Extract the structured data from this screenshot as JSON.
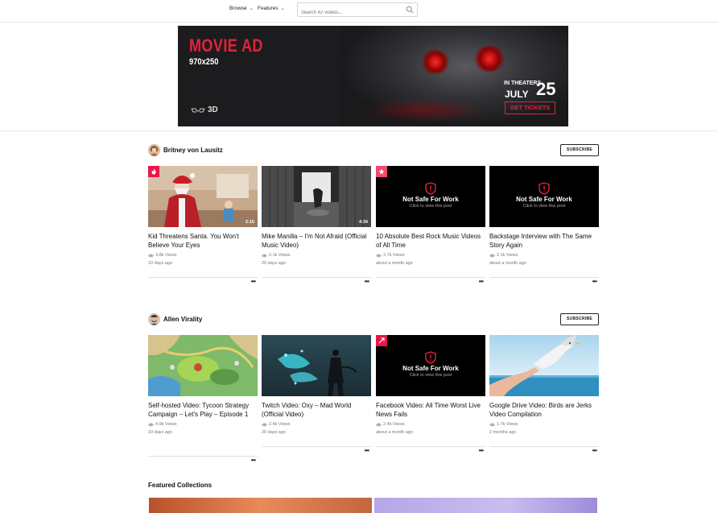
{
  "nav": {
    "browse_label": "Browse",
    "features_label": "Features",
    "search_placeholder": "Search 42 videos..."
  },
  "ad": {
    "title": "MOVIE AD",
    "size": "970x250",
    "format_label": "3D",
    "theaters_label": "IN THEATERS",
    "month_label": "JULY",
    "day_label": "25",
    "cta_label": "GET TICKETS"
  },
  "channels": [
    {
      "name": "Britney von Lausitz",
      "subscribe_label": "SUBSCRIBE",
      "videos": [
        {
          "title": "Kid Threatens Santa. You Won't Believe Your Eyes",
          "views": "3.8k Views",
          "age": "19 days ago",
          "duration": "2:15"
        },
        {
          "title": "Mike Manilla – I'm Not Afraid (Official Music Video)",
          "views": "2.1k Views",
          "age": "20 days ago",
          "duration": "4:34"
        },
        {
          "title": "10 Absolute Best Rock Music Videos of All Time",
          "views": "2.7k Views",
          "age": "about a month ago",
          "nsfw_title": "Not Safe For Work",
          "nsfw_sub": "Click to view this post"
        },
        {
          "title": "Backstage Interview with The Same Story Again",
          "views": "2.1k Views",
          "age": "about a month ago",
          "nsfw_title": "Not Safe For Work",
          "nsfw_sub": "Click to view this post"
        }
      ]
    },
    {
      "name": "Allen Virality",
      "subscribe_label": "SUBSCRIBE",
      "videos": [
        {
          "title": "Self-hosted Video: Tycoon Strategy Campaign – Let's Play – Episode 1",
          "views": "4.9k Views",
          "age": "19 days ago"
        },
        {
          "title": "Twitch Video: Oxy – Mad World (Official Video)",
          "views": "2.4k Views",
          "age": "20 days ago"
        },
        {
          "title": "Facebook Video: All Time Worst Live News Fails",
          "views": "2.4k Views",
          "age": "about a month ago",
          "nsfw_title": "Not Safe For Work",
          "nsfw_sub": "Click to view this post"
        },
        {
          "title": "Google Drive Video: Birds are Jerks Video Compilation",
          "views": "1.7k Views",
          "age": "2 months ago"
        }
      ]
    }
  ],
  "featured_collections_label": "Featured Collections",
  "colors": {
    "accent": "#e3223a",
    "hot_badge": "#e8174a",
    "trending_badge": "#f04a6e"
  }
}
